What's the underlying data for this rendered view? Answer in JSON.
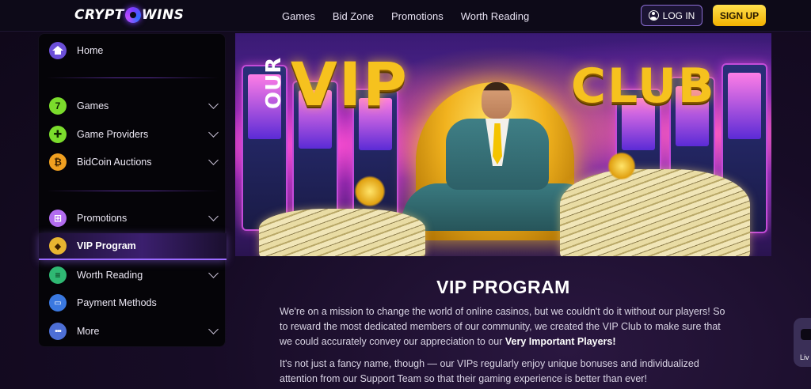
{
  "header": {
    "logo_left": "CRYPT",
    "logo_right": "WINS",
    "nav": [
      "Games",
      "Bid Zone",
      "Promotions",
      "Worth Reading"
    ],
    "login_label": "LOG IN",
    "signup_label": "SIGN UP"
  },
  "sidebar": {
    "items": [
      {
        "label": "Home",
        "icon": "home-icon"
      },
      {
        "label": "Games",
        "icon": "seven-icon",
        "glyph": "7"
      },
      {
        "label": "Game Providers",
        "icon": "puzzle-icon",
        "glyph": "✚"
      },
      {
        "label": "BidCoin Auctions",
        "icon": "bitcoin-icon",
        "glyph": "₿"
      },
      {
        "label": "Promotions",
        "icon": "gift-icon",
        "glyph": "⊞"
      },
      {
        "label": "VIP Program",
        "icon": "diamond-icon",
        "glyph": "◆"
      },
      {
        "label": "Worth Reading",
        "icon": "book-icon",
        "glyph": "≡"
      },
      {
        "label": "Payment Methods",
        "icon": "wallet-icon",
        "glyph": "▭"
      },
      {
        "label": "More",
        "icon": "more-icon",
        "glyph": "•••"
      }
    ],
    "active": "VIP Program"
  },
  "hero": {
    "word_our": "OUR",
    "word_vip": "VIP",
    "word_club": "CLUB"
  },
  "content": {
    "title": "VIP PROGRAM",
    "p1_text": "We're on a mission to change the world of online casinos, but we couldn't do it without our players! So to reward the most dedicated members of our community, we created the VIP Club to make sure that we could accurately convey our appreciation to our ",
    "p1_bold": "Very Important Players!",
    "p2_text": "It's not just a fancy name, though — our VIPs regularly enjoy unique bonuses and individualized attention from our Support Team so that their gaming experience is better than ever!"
  },
  "live_chat": {
    "label": "Liv"
  },
  "colors": {
    "accent_purple": "#9b6bff",
    "signup_yellow": "#f5c400",
    "background": "#170c26"
  }
}
